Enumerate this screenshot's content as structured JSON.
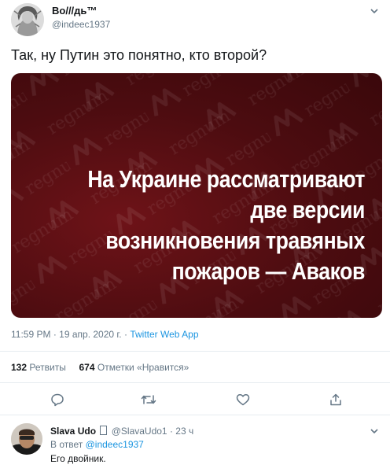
{
  "tweet": {
    "author_name": "Bo///дь™",
    "author_handle": "@indeec1937",
    "text": "Так, ну Путин это понятно, кто второй?",
    "media": {
      "headline_lines": [
        "На Украине рассматривают",
        "две версии",
        "возникновения травяных",
        "пожаров — Аваков"
      ],
      "watermark": "regnum"
    },
    "time": "11:59 PM",
    "date": "19 апр. 2020 г.",
    "separator": "·",
    "source_app": "Twitter Web App",
    "retweets_count": "132",
    "retweets_label": "Ретвиты",
    "likes_count": "674",
    "likes_label": "Отметки «Нравится»"
  },
  "reply": {
    "author_name": "Slava Udo",
    "author_handle": "@SlavaUdo1",
    "age": "23 ч",
    "reply_prefix": "В ответ",
    "reply_to": "@indeec1937",
    "text": "Его двойник."
  },
  "colors": {
    "link": "#1b95e0",
    "muted": "#657786",
    "media_bg": "#4c0c10"
  },
  "icons": [
    "chevron-down-icon",
    "reply-icon",
    "retweet-icon",
    "like-icon",
    "share-icon"
  ]
}
